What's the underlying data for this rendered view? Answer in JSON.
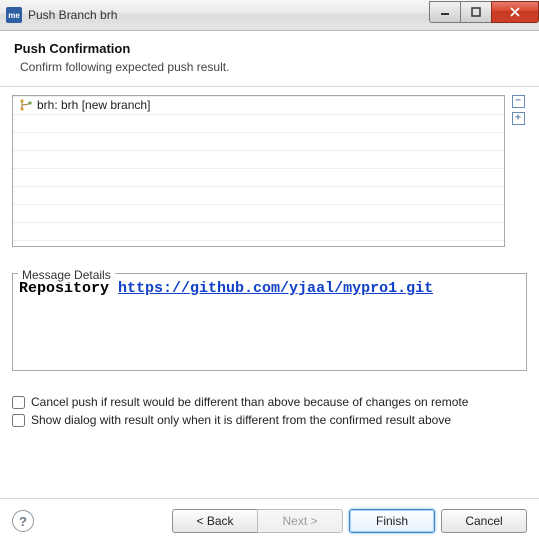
{
  "window": {
    "app_icon_text": "me",
    "title": "Push Branch brh"
  },
  "header": {
    "title": "Push Confirmation",
    "subtitle": "Confirm following expected push result."
  },
  "results": {
    "items": [
      {
        "label": "brh: brh [new branch]"
      }
    ]
  },
  "side_controls": {
    "collapse": "−",
    "expand": "+"
  },
  "message_details": {
    "label": "Message Details",
    "repo_label": "Repository",
    "repo_url": "https://github.com/yjaal/mypro1.git"
  },
  "options": {
    "cancel_push": "Cancel push if result would be different than above because of changes on remote",
    "show_dialog": "Show dialog with result only when it is different from the confirmed result above"
  },
  "footer": {
    "help": "?",
    "back": "< Back",
    "next": "Next >",
    "finish": "Finish",
    "cancel": "Cancel"
  }
}
